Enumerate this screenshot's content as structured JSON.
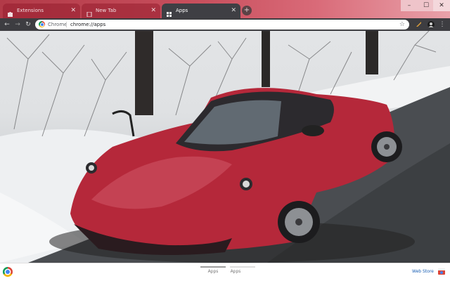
{
  "tabs": [
    {
      "label": "Extensions",
      "active": false,
      "icon": "puzzle-icon"
    },
    {
      "label": "New Tab",
      "active": false,
      "icon": "page-icon"
    },
    {
      "label": "Apps",
      "active": true,
      "icon": "apps-grid-icon"
    }
  ],
  "new_tab_icon": "+",
  "window_controls": {
    "minimize": "–",
    "maximize": "☐",
    "close": "✕"
  },
  "toolbar": {
    "back_icon": "←",
    "forward_icon": "→",
    "reload_icon": "↻",
    "scheme_label": "Chrome",
    "url": "chrome://apps",
    "star_icon": "☆",
    "extension_icon": "🖌",
    "menu_icon": "⋮"
  },
  "apps_pages": [
    {
      "label": "Apps",
      "active": true
    },
    {
      "label": "Apps",
      "active": false
    }
  ],
  "webstore_label": "Web Store",
  "colors": {
    "frame_red": "#b23a48",
    "toolbar_dark": "#3d3d41",
    "car_red": "#b5283a",
    "link_blue": "#1a5fb4"
  }
}
